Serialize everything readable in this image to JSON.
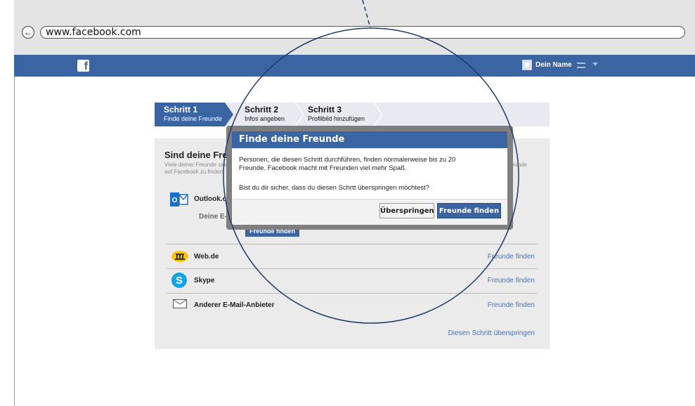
{
  "browser": {
    "url": "www.facebook.com"
  },
  "fb_header": {
    "logo": "f",
    "user_name": "Dein Name"
  },
  "steps": [
    {
      "title": "Schritt 1",
      "subtitle": "Finde deine Freunde"
    },
    {
      "title": "Schritt 2",
      "subtitle": "Infos angeben"
    },
    {
      "title": "Schritt 3",
      "subtitle": "Profilbild hinzufügen"
    }
  ],
  "main": {
    "heading": "Sind deine Freunde",
    "subtext_line1": "Viele deiner Freunde sind",
    "subtext_line2": "auf Facebook zu finden",
    "right_fragment": "Freunde",
    "outlook_label": "Outlook.com",
    "email_label": "Deine E-Mail",
    "find_button": "Freunde finden",
    "services": [
      {
        "name": "Web.de",
        "link": "Freunde finden"
      },
      {
        "name": "Skype",
        "link": "Freunde finden"
      },
      {
        "name": "Anderer E-Mail-Anbieter",
        "link": "Freunde finden"
      }
    ],
    "skip_link": "Diesen Schritt überspringen"
  },
  "dialog": {
    "title": "Finde deine Freunde",
    "body_line1": "Personen, die diesen Schritt durchführen, finden normalerweise bis zu 20",
    "body_line2": "Freunde. Facebook macht mit Freunden viel mehr Spaß.",
    "question": "Bist du dir sicher, dass du diesen Schrtt überspringen möchtest?",
    "skip_button": "Überspringen",
    "find_button": "Freunde finden"
  },
  "colors": {
    "facebook_blue": "#3b64a2",
    "link_blue": "#4a73b2",
    "overlay_line": "#1f3b6e"
  }
}
